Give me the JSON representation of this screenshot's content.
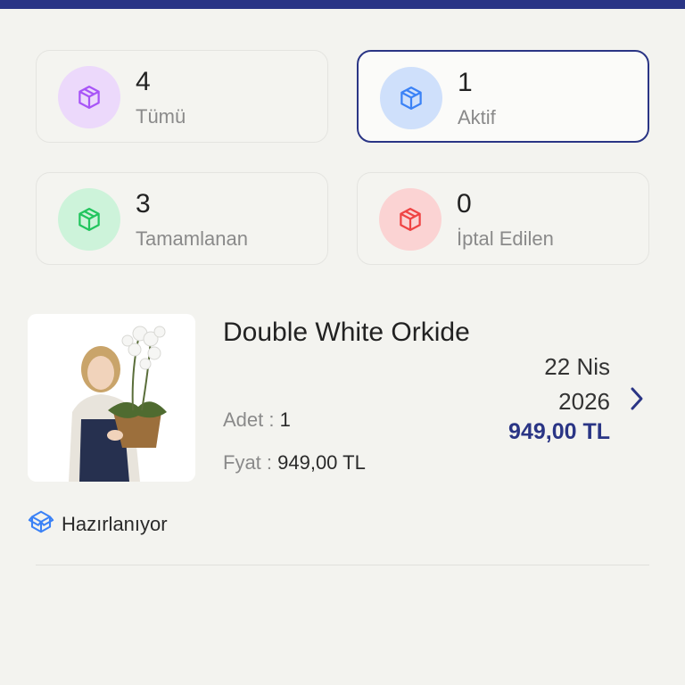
{
  "colors": {
    "brand": "#2a3585",
    "all": "#a855f7",
    "active": "#3b82f6",
    "completed": "#22c55e",
    "cancelled": "#ef4444"
  },
  "stats": [
    {
      "count": "4",
      "label": "Tümü",
      "icon": "package-icon"
    },
    {
      "count": "1",
      "label": "Aktif",
      "icon": "package-icon"
    },
    {
      "count": "3",
      "label": "Tamamlanan",
      "icon": "package-icon"
    },
    {
      "count": "0",
      "label": "İptal Edilen",
      "icon": "package-icon"
    }
  ],
  "order": {
    "name": "Double White Orkide",
    "date_day": "22 Nis",
    "date_year": "2026",
    "price": "949,00 TL",
    "qty_label": "Adet : ",
    "qty_value": "1",
    "unit_price_label": "Fyat : ",
    "unit_price_value": "949,00 TL",
    "status": "Hazırlanıyor"
  }
}
